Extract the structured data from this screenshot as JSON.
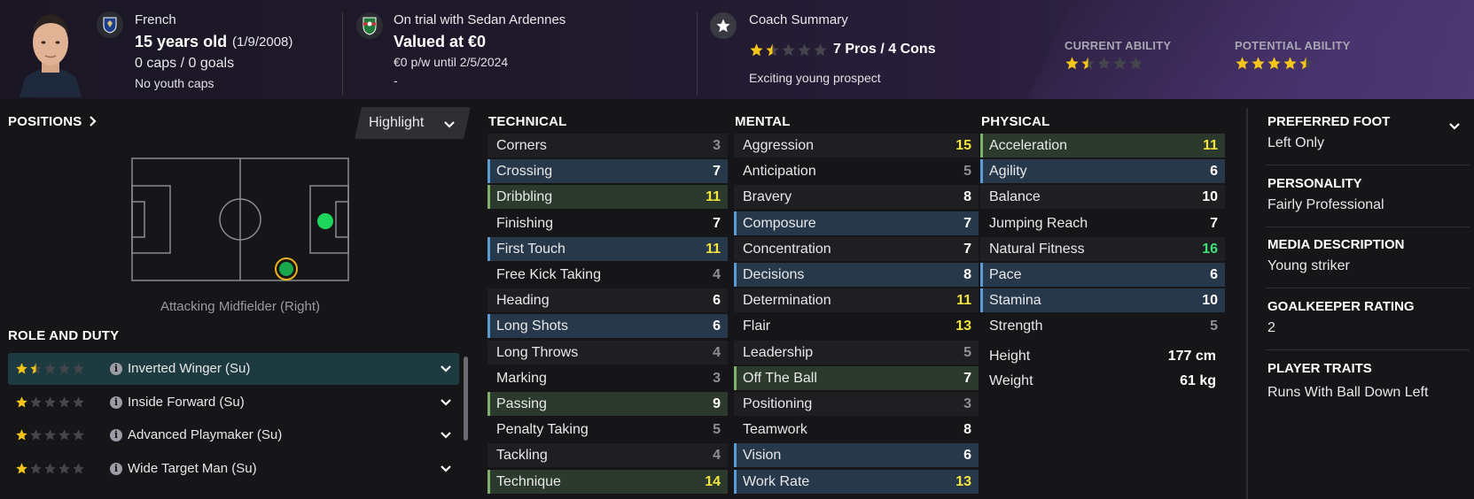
{
  "header": {
    "nationality": "French",
    "age": "15 years old",
    "dob": "(1/9/2008)",
    "caps": "0 caps / 0 goals",
    "youth_caps": "No youth caps",
    "club_status": "On trial with Sedan Ardennes",
    "value": "Valued at €0",
    "contract": "€0 p/w until 2/5/2024",
    "contract_extra": "-",
    "coach_title": "Coach Summary",
    "coach_pros_cons": "7 Pros / 4 Cons",
    "coach_rating_stars": 1.5,
    "coach_comment": "Exciting young prospect",
    "current_ability_label": "CURRENT ABILITY",
    "current_ability_stars": 1.5,
    "potential_ability_label": "POTENTIAL ABILITY",
    "potential_ability_stars": 4.5
  },
  "positions": {
    "title": "POSITIONS",
    "highlight_label": "Highlight",
    "caption": "Attacking Midfielder (Right)"
  },
  "roles": {
    "title": "ROLE AND DUTY",
    "items": [
      {
        "name": "Inverted Winger (Su)",
        "stars": 1.5
      },
      {
        "name": "Inside Forward (Su)",
        "stars": 1
      },
      {
        "name": "Advanced Playmaker (Su)",
        "stars": 1
      },
      {
        "name": "Wide Target Man (Su)",
        "stars": 1
      }
    ]
  },
  "technical": {
    "title": "TECHNICAL",
    "items": [
      {
        "name": "Corners",
        "value": "3",
        "color": "grey",
        "hl": ""
      },
      {
        "name": "Crossing",
        "value": "7",
        "color": "white",
        "hl": "blue"
      },
      {
        "name": "Dribbling",
        "value": "11",
        "color": "yellow",
        "hl": "green"
      },
      {
        "name": "Finishing",
        "value": "7",
        "color": "white",
        "hl": ""
      },
      {
        "name": "First Touch",
        "value": "11",
        "color": "yellow",
        "hl": "blue"
      },
      {
        "name": "Free Kick Taking",
        "value": "4",
        "color": "grey",
        "hl": ""
      },
      {
        "name": "Heading",
        "value": "6",
        "color": "white",
        "hl": ""
      },
      {
        "name": "Long Shots",
        "value": "6",
        "color": "white",
        "hl": "blue"
      },
      {
        "name": "Long Throws",
        "value": "4",
        "color": "grey",
        "hl": ""
      },
      {
        "name": "Marking",
        "value": "3",
        "color": "grey",
        "hl": ""
      },
      {
        "name": "Passing",
        "value": "9",
        "color": "white",
        "hl": "green"
      },
      {
        "name": "Penalty Taking",
        "value": "5",
        "color": "grey",
        "hl": ""
      },
      {
        "name": "Tackling",
        "value": "4",
        "color": "grey",
        "hl": ""
      },
      {
        "name": "Technique",
        "value": "14",
        "color": "yellow",
        "hl": "green"
      }
    ]
  },
  "mental": {
    "title": "MENTAL",
    "items": [
      {
        "name": "Aggression",
        "value": "15",
        "color": "yellow",
        "hl": ""
      },
      {
        "name": "Anticipation",
        "value": "5",
        "color": "grey",
        "hl": ""
      },
      {
        "name": "Bravery",
        "value": "8",
        "color": "white",
        "hl": ""
      },
      {
        "name": "Composure",
        "value": "7",
        "color": "white",
        "hl": "blue"
      },
      {
        "name": "Concentration",
        "value": "7",
        "color": "white",
        "hl": ""
      },
      {
        "name": "Decisions",
        "value": "8",
        "color": "white",
        "hl": "blue"
      },
      {
        "name": "Determination",
        "value": "11",
        "color": "yellow",
        "hl": ""
      },
      {
        "name": "Flair",
        "value": "13",
        "color": "yellow",
        "hl": ""
      },
      {
        "name": "Leadership",
        "value": "5",
        "color": "grey",
        "hl": ""
      },
      {
        "name": "Off The Ball",
        "value": "7",
        "color": "white",
        "hl": "green"
      },
      {
        "name": "Positioning",
        "value": "3",
        "color": "grey",
        "hl": ""
      },
      {
        "name": "Teamwork",
        "value": "8",
        "color": "white",
        "hl": ""
      },
      {
        "name": "Vision",
        "value": "6",
        "color": "white",
        "hl": "blue"
      },
      {
        "name": "Work Rate",
        "value": "13",
        "color": "yellow",
        "hl": "blue"
      }
    ]
  },
  "physical": {
    "title": "PHYSICAL",
    "items": [
      {
        "name": "Acceleration",
        "value": "11",
        "color": "yellow",
        "hl": "green"
      },
      {
        "name": "Agility",
        "value": "6",
        "color": "white",
        "hl": "blue"
      },
      {
        "name": "Balance",
        "value": "10",
        "color": "white",
        "hl": ""
      },
      {
        "name": "Jumping Reach",
        "value": "7",
        "color": "white",
        "hl": ""
      },
      {
        "name": "Natural Fitness",
        "value": "16",
        "color": "green",
        "hl": ""
      },
      {
        "name": "Pace",
        "value": "6",
        "color": "white",
        "hl": "blue"
      },
      {
        "name": "Stamina",
        "value": "10",
        "color": "white",
        "hl": "blue"
      },
      {
        "name": "Strength",
        "value": "5",
        "color": "grey",
        "hl": ""
      }
    ],
    "height_label": "Height",
    "height_value": "177 cm",
    "weight_label": "Weight",
    "weight_value": "61 kg"
  },
  "info": {
    "preferred_foot_label": "PREFERRED FOOT",
    "preferred_foot": "Left Only",
    "personality_label": "PERSONALITY",
    "personality": "Fairly Professional",
    "media_label": "MEDIA DESCRIPTION",
    "media": "Young striker",
    "gk_label": "GOALKEEPER RATING",
    "gk": "2",
    "traits_label": "PLAYER TRAITS",
    "traits": "Runs With Ball Down Left"
  },
  "colors": {
    "yellow_value": "#f2e43a",
    "green_value": "#3fe07a",
    "grey_value": "#8e8e96",
    "star_gold": "#f5c518",
    "highlight_blue": "#27384a",
    "highlight_green": "#2b3a2c",
    "position_dot": "#1fd65c"
  }
}
